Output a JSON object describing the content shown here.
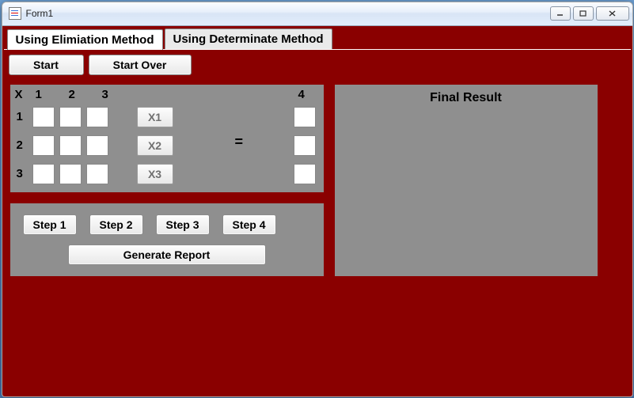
{
  "window": {
    "title": "Form1"
  },
  "tabs": {
    "elimination": "Using Elimiation Method",
    "determinate": "Using Determinate Method"
  },
  "toolbar": {
    "start": "Start",
    "start_over": "Start Over"
  },
  "matrix": {
    "corner": "X",
    "col1": "1",
    "col2": "2",
    "col3": "3",
    "col4": "4",
    "row1": "1",
    "row2": "2",
    "row3": "3",
    "x1": "X1",
    "x2": "X2",
    "x3": "X3",
    "equals": "="
  },
  "steps": {
    "s1": "Step 1",
    "s2": "Step 2",
    "s3": "Step 3",
    "s4": "Step 4",
    "generate": "Generate Report"
  },
  "final": {
    "title": "Final Result"
  }
}
